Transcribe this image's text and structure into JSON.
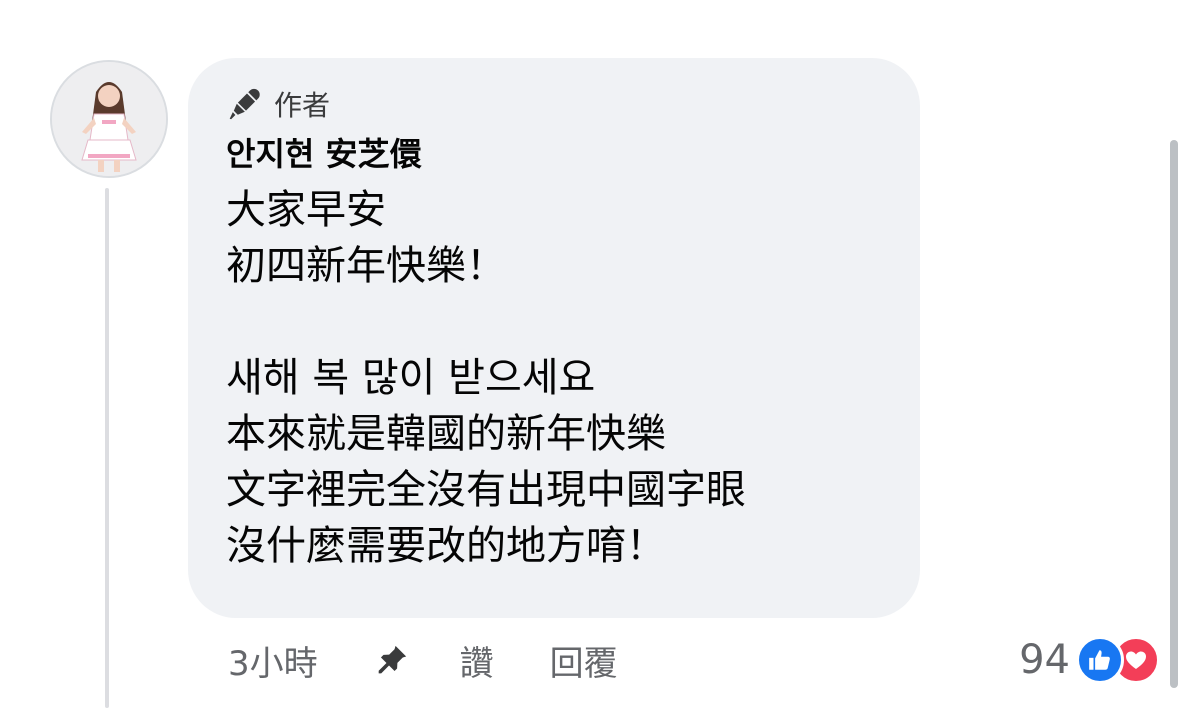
{
  "comment": {
    "author_badge_label": "作者",
    "author_name": "안지현 安芝儇",
    "lines": [
      "大家早安",
      "初四新年快樂！",
      "",
      "새해 복 많이 받으세요",
      "本來就是韓國的新年快樂",
      "文字裡完全沒有出現中國字眼",
      "沒什麼需要改的地方唷！"
    ]
  },
  "actions": {
    "timestamp": "3小時",
    "like_label": "讚",
    "reply_label": "回覆"
  },
  "reactions": {
    "count": "94",
    "types": [
      "like-icon",
      "love-icon"
    ]
  },
  "colors": {
    "bubble": "#f0f2f5",
    "secondary_text": "#65676b",
    "like_blue": "#1877f2",
    "love_red": "#f33e58"
  },
  "icons": {
    "badge": "microphone-icon",
    "pin": "pin-icon"
  }
}
